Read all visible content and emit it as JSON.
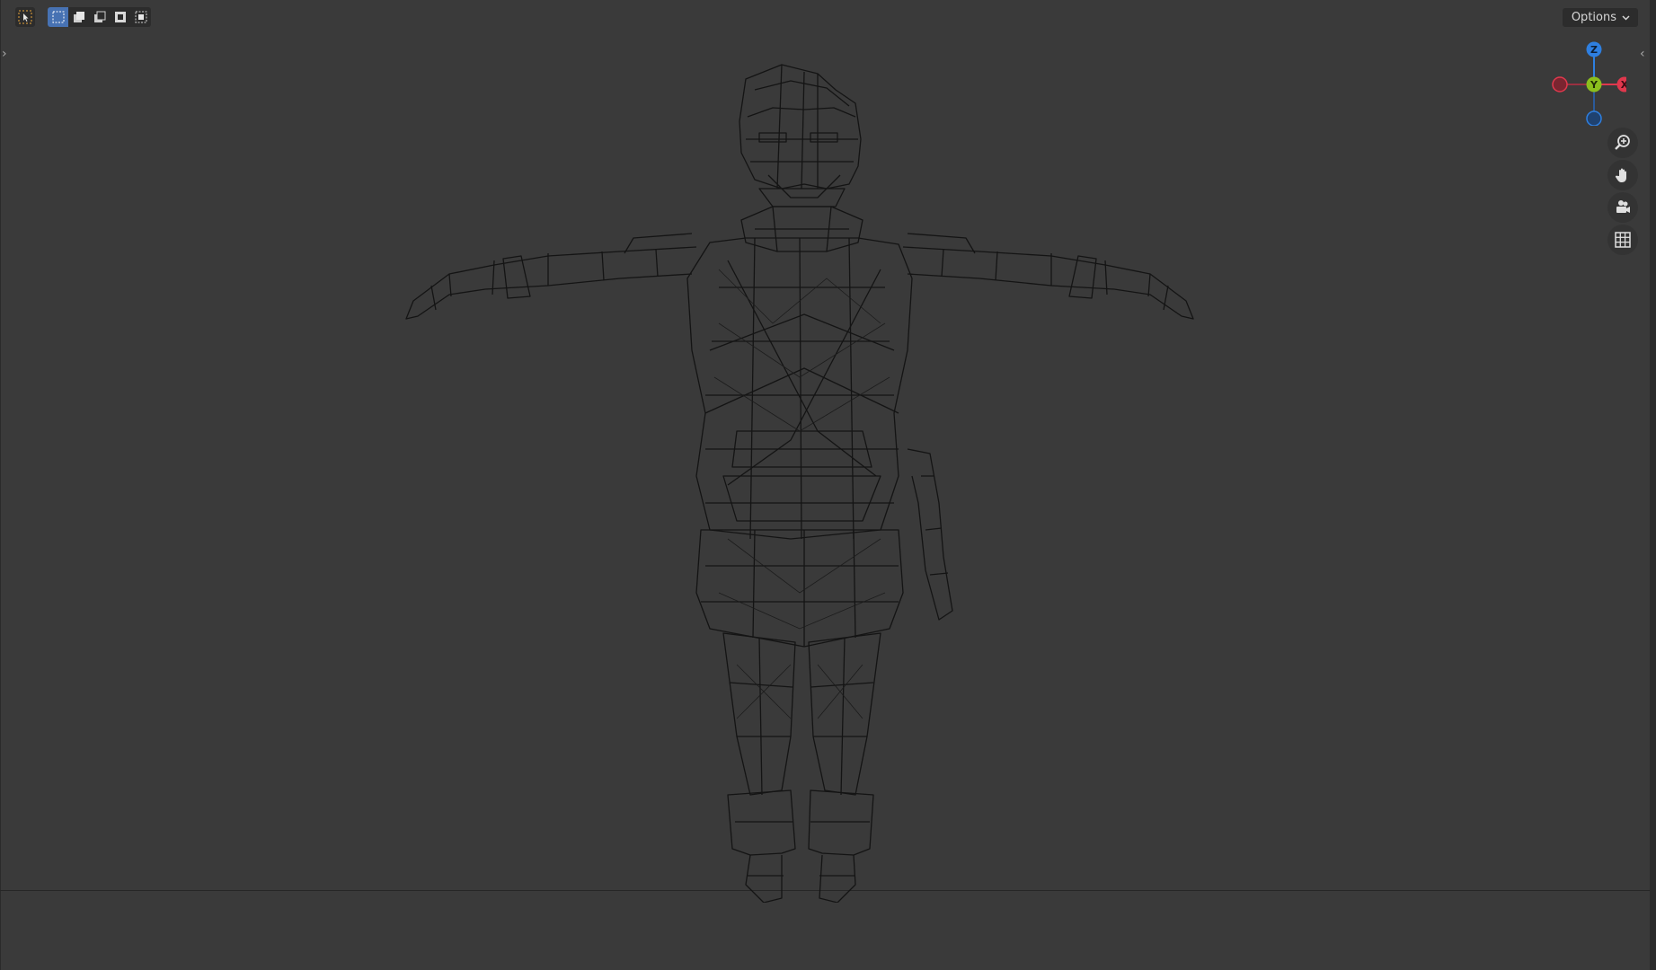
{
  "toolbar": {
    "select_tool_icon": "select-cursor-icon",
    "modes": [
      {
        "icon": "select-new-icon",
        "active": true
      },
      {
        "icon": "select-extend-icon",
        "active": false
      },
      {
        "icon": "select-subtract-icon",
        "active": false
      },
      {
        "icon": "select-difference-icon",
        "active": false
      },
      {
        "icon": "select-intersect-icon",
        "active": false
      }
    ],
    "options_label": "Options"
  },
  "gizmo": {
    "axes": {
      "z": "Z",
      "y": "Y",
      "x": "X"
    },
    "colors": {
      "x": "#e0384d",
      "y": "#8bbf1d",
      "z": "#2e7fe0"
    }
  },
  "navigation": [
    "zoom-icon",
    "hand-pan-icon",
    "camera-icon",
    "grid-perspective-icon"
  ],
  "colors": {
    "background": "#3a3a3a",
    "active_accent": "#4772b3",
    "wireframe": "#121212"
  }
}
